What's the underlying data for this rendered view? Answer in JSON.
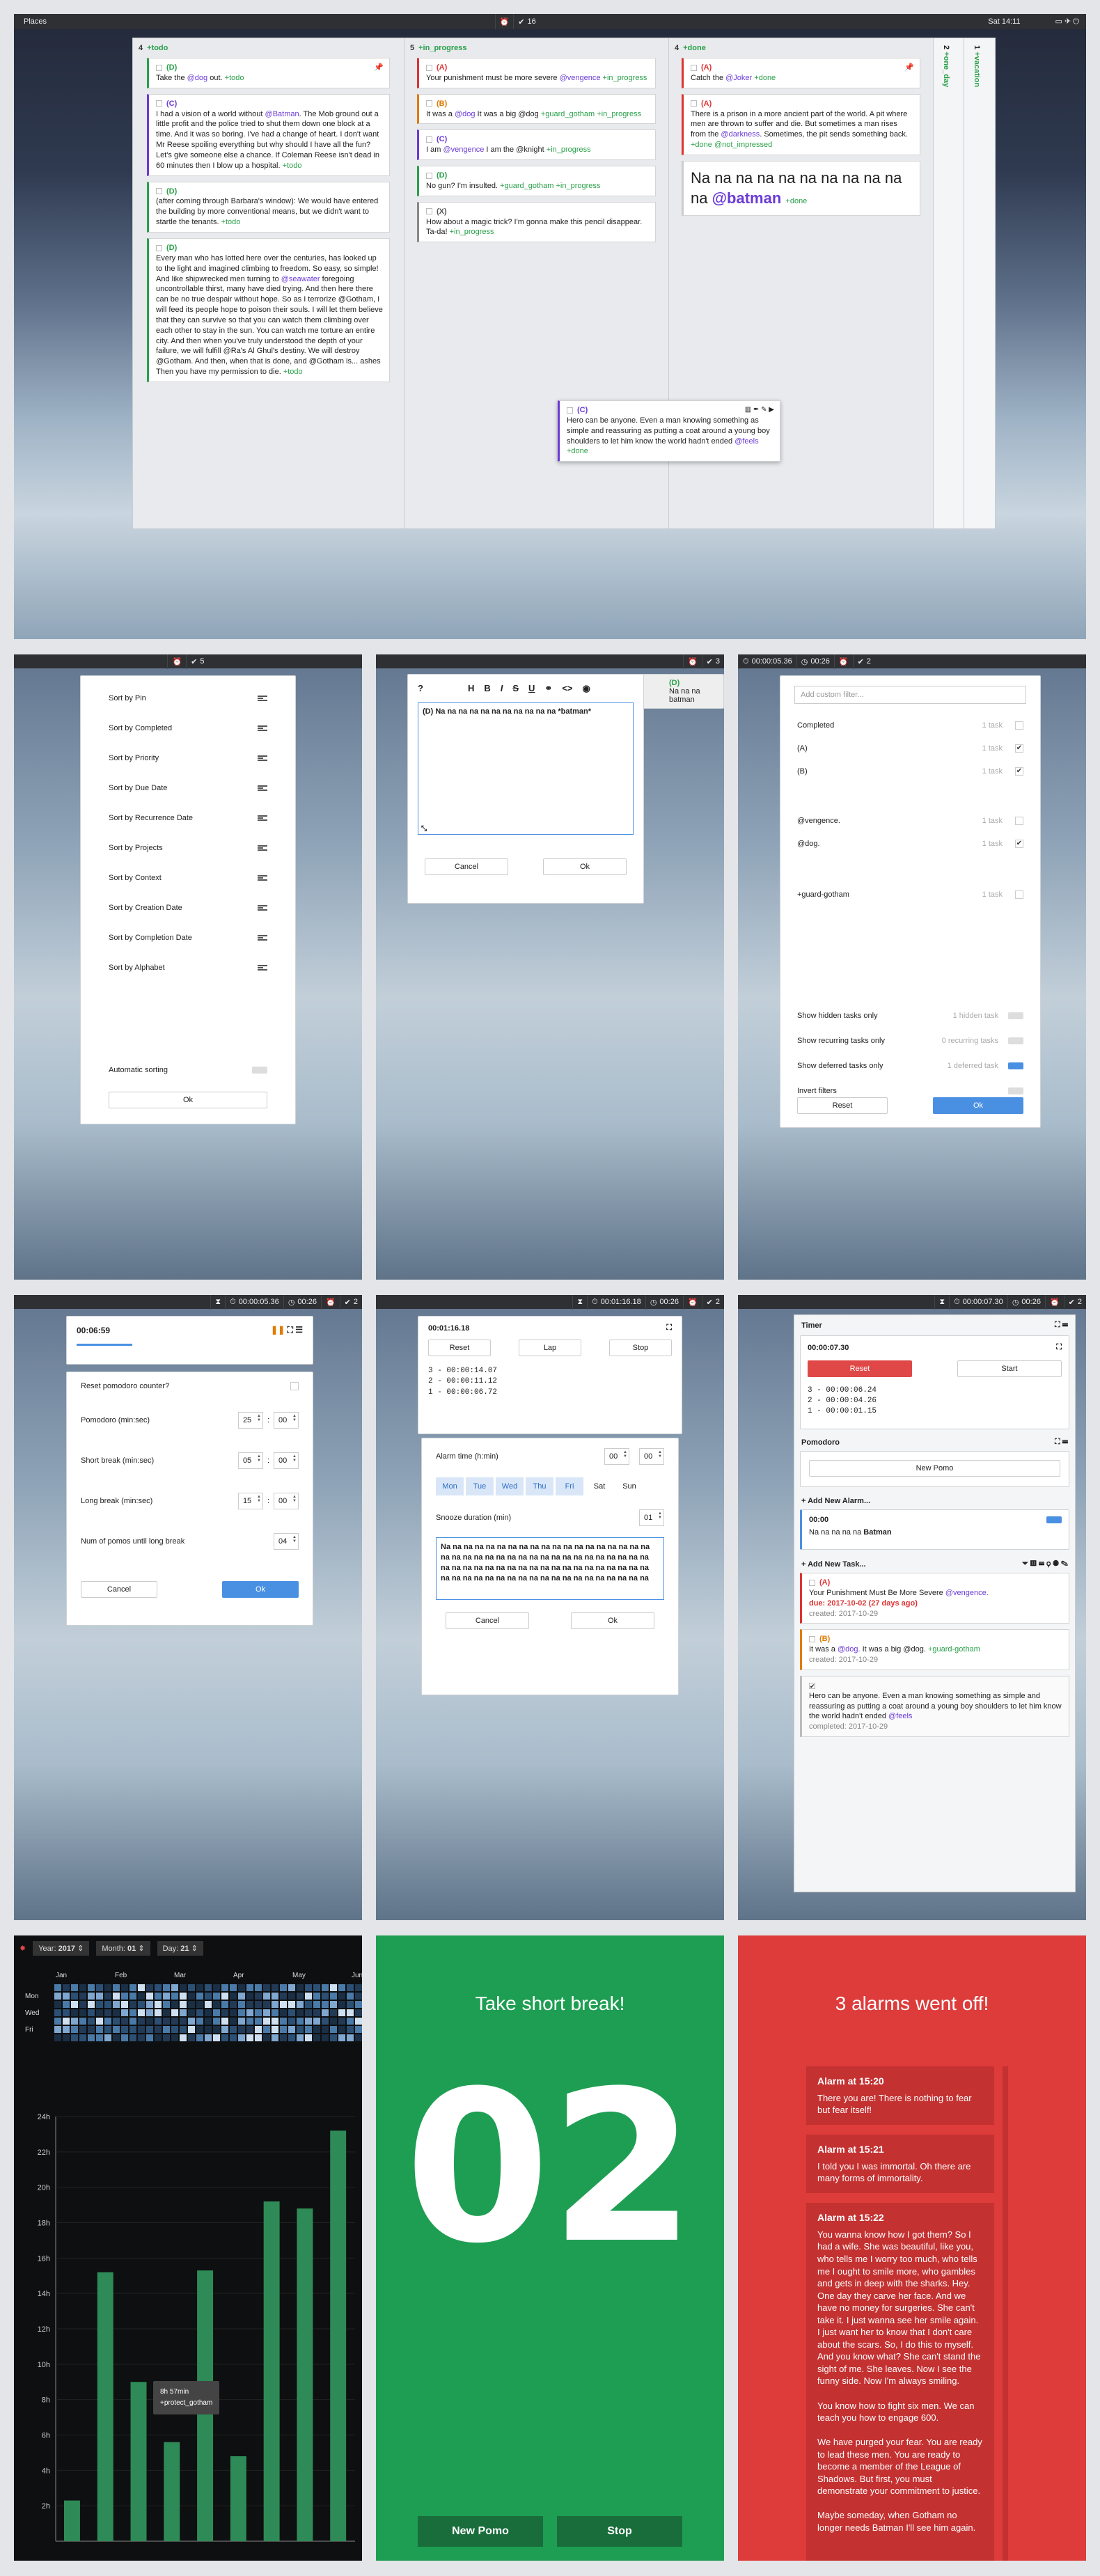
{
  "p1": {
    "topbar": {
      "title": "Places",
      "count": "16",
      "clock": "Sat 14:11"
    },
    "col_todo": {
      "count": "4",
      "title": "+todo",
      "tasks": [
        {
          "pri": "(D)",
          "text": "Take the ",
          "ctx": "@dog",
          "rest": " out. ",
          "tag": "+todo",
          "pinned": true
        },
        {
          "pri": "(C)",
          "text": "I had a vision of a world without ",
          "ctx": "@Batman",
          "rest": ". The Mob ground out a little profit and the police tried to shut them down one block at a time. And it was so boring. I've had a change of heart. I don't want Mr Reese spoiling everything but why should I have all the fun? Let's give someone else a chance. If Coleman Reese isn't dead in 60 minutes then I blow up a hospital. ",
          "tag": "+todo"
        },
        {
          "pri": "(D)",
          "text": "(after coming through Barbara's window): We would have entered the building by more conventional means, but we didn't want to startle the tenants. ",
          "ctx": "",
          "rest": "",
          "tag": "+todo"
        },
        {
          "pri": "(D)",
          "text": "Every man who has lotted here over the centuries, has looked up to the light and imagined climbing to freedom. So easy, so simple! And like shipwrecked men turning to ",
          "ctx": "@seawater",
          "rest": " foregoing uncontrollable thirst, many have died trying. And then here there can be no true despair without hope. So as I terrorize @Gotham, I will feed its people hope to poison their souls. I will let them believe that they can survive so that you can watch them climbing over each other to stay in the sun. You can watch me torture an entire city. And then when you've truly understood the depth of your failure, we will fulfill @Ra's Al Ghul's destiny. We will destroy @Gotham. And then, when that is done, and @Gotham is... ashes Then you have my permission to die. ",
          "tag": "+todo"
        }
      ]
    },
    "col_prog": {
      "count": "5",
      "title": "+in_progress",
      "tasks": [
        {
          "pri": "(A)",
          "text": "Your punishment must be more severe ",
          "ctx": "@vengence",
          "rest": " ",
          "tag": "+in_progress",
          "color": "#d33"
        },
        {
          "pri": "(B)",
          "text": "It was a ",
          "ctx": "@dog",
          "rest": " It was a big @dog ",
          "tag": "+guard_gotham +in_progress",
          "color": "#e07b00"
        },
        {
          "pri": "(C)",
          "text": "I am ",
          "ctx": "@vengence",
          "rest": " I am the @knight ",
          "tag": "+in_progress",
          "color": "#6b3bd6"
        },
        {
          "pri": "(D)",
          "text": "No gun? I'm insulted. ",
          "ctx": "",
          "rest": "",
          "tag": "+guard_gotham +in_progress",
          "color": "#2aa04a"
        },
        {
          "pri": "(X)",
          "text": "How about a magic trick? I'm gonna make this pencil disappear. Ta-da! ",
          "ctx": "",
          "rest": "",
          "tag": "+in_progress",
          "color": "#888"
        }
      ]
    },
    "col_done": {
      "count": "4",
      "title": "+done",
      "tasks": [
        {
          "pri": "(A)",
          "text": "Catch the ",
          "ctx": "@Joker",
          "rest": " ",
          "tag": "+done"
        },
        {
          "pri": "(A)",
          "text": "There is a prison in a more ancient part of the world. A pit where men are thrown to suffer and die. But sometimes a man rises from the ",
          "ctx": "@darkness",
          "rest": ". Sometimes, the pit sends something back. ",
          "tag": "+done @not_impressed"
        },
        {
          "pri": "",
          "text": "Na na na na na na na na na na na ",
          "ctx": "@batman",
          "rest": " ",
          "tag": "+done"
        }
      ]
    },
    "floating": {
      "pri": "(C)",
      "text": "Hero can be anyone. Even a man knowing something as simple and reassuring as putting a coat around a young boy shoulders to let him know the world hadn't ended ",
      "ctx": "@feels",
      "tag": "+done"
    },
    "side1": {
      "num": "2",
      "label": "+one_day"
    },
    "side2": {
      "num": "1",
      "label": "+vacation"
    }
  },
  "p2": {
    "count": "5",
    "items": [
      "Sort by Pin",
      "Sort by Completed",
      "Sort by Priority",
      "Sort by Due Date",
      "Sort by Recurrence Date",
      "Sort by Projects",
      "Sort by Context",
      "Sort by Creation Date",
      "Sort by Completion Date",
      "Sort by Alphabet"
    ],
    "auto": "Automatic sorting",
    "ok": "Ok"
  },
  "p3": {
    "count": "3",
    "toolbar": [
      "?",
      "H",
      "B",
      "I",
      "S",
      "U",
      "<>"
    ],
    "text": "(D) Na na na na na na na na na na na *batman*",
    "cancel": "Cancel",
    "ok": "Ok",
    "peek_pri": "(D)",
    "peek_text": "Na na na batman"
  },
  "p4": {
    "timer": "00:00:05.36",
    "pomo": "00:26",
    "count": "2",
    "placeholder": "Add custom filter...",
    "filters": [
      {
        "label": "Completed",
        "info": "1 task",
        "checked": false
      },
      {
        "label": "(A)",
        "info": "1 task",
        "checked": true
      },
      {
        "label": "(B)",
        "info": "1 task",
        "checked": true
      },
      {
        "label": "@vengence.",
        "info": "1 task",
        "checked": false
      },
      {
        "label": "@dog.",
        "info": "1 task",
        "checked": true
      },
      {
        "label": "+guard-gotham",
        "info": "1 task",
        "checked": false
      }
    ],
    "toggles": [
      {
        "label": "Show hidden tasks only",
        "info": "1 hidden task",
        "on": false
      },
      {
        "label": "Show recurring tasks only",
        "info": "0 recurring tasks",
        "on": false
      },
      {
        "label": "Show deferred tasks only",
        "info": "1 deferred task",
        "on": true
      },
      {
        "label": "Invert filters",
        "info": "",
        "on": false
      }
    ],
    "reset": "Reset",
    "ok": "Ok"
  },
  "p5": {
    "timer": "00:00:05.36",
    "pomo": "00:26",
    "count": "2",
    "time": "00:06:59",
    "reset_label": "Reset pomodoro counter?",
    "fields": [
      {
        "label": "Pomodoro (min:sec)",
        "a": "25",
        "b": "00"
      },
      {
        "label": "Short break (min:sec)",
        "a": "05",
        "b": "00"
      },
      {
        "label": "Long break (min:sec)",
        "a": "15",
        "b": "00"
      },
      {
        "label": "Num of pomos until long break",
        "a": "",
        "b": "04"
      }
    ],
    "cancel": "Cancel",
    "ok": "Ok"
  },
  "p6": {
    "timer": "00:01:16.18",
    "pomo": "00:26",
    "count": "2",
    "sw_time": "00:01:16.18",
    "reset": "Reset",
    "lap": "Lap",
    "stop": "Stop",
    "laps": [
      "3 - 00:00:14.07",
      "2 - 00:00:11.12",
      "1 - 00:00:06.72"
    ],
    "alarm_label": "Alarm time (h:min)",
    "h": "00",
    "m": "00",
    "days": [
      "Mon",
      "Tue",
      "Wed",
      "Thu",
      "Fri",
      "Sat",
      "Sun"
    ],
    "snooze_label": "Snooze duration (min)",
    "snooze": "01",
    "msg": "Na na na na na na na na na na na na na na na na na na na na na na na na na na na na na na na na na na na na na na na na na na na na na na na na na na na na na na na na na na na na na na na na na na na na na na na na na na na na",
    "cancel": "Cancel",
    "ok": "Ok"
  },
  "p7": {
    "timer": "00:00:07.30",
    "pomo": "00:26",
    "count": "2",
    "timer_title": "Timer",
    "t_time": "00:00:07.30",
    "reset": "Reset",
    "start": "Start",
    "laps": [
      "3 - 00:00:06.24",
      "2 - 00:00:04.26",
      "1 - 00:00:01.15"
    ],
    "pomo_title": "Pomodoro",
    "new_pomo": "New Pomo",
    "add_alarm": "Add New Alarm...",
    "alarm_time": "00:00",
    "alarm_text": "Na na na na na ",
    "alarm_ctx": "Batman",
    "add_task": "Add New Task...",
    "tasks": [
      {
        "pri": "(A)",
        "text": "Your Punishment Must Be More Severe ",
        "ctx": "@vengence.",
        "due": "due: 2017-10-02 (27 days ago)",
        "created": "created: 2017-10-29",
        "color": "#d33"
      },
      {
        "pri": "(B)",
        "text": "It was a ",
        "ctx": "@dog.",
        "rest": " It was a big @dog. ",
        "tag": "+guard-gotham",
        "created": "created: 2017-10-29",
        "color": "#e07b00"
      },
      {
        "pri": "",
        "text": "Hero can be anyone. Even a man knowing something as simple and reassuring as putting a coat around a young boy shoulders to let him know the world hadn't ended ",
        "ctx": "@feels",
        "created": "completed: 2017-10-29",
        "color": "#bbb"
      }
    ]
  },
  "p8": {
    "year_label": "Year:",
    "year": "2017",
    "month_label": "Month:",
    "month": "01",
    "day_label": "Day:",
    "day": "21",
    "months": [
      "Jan",
      "Feb",
      "Mar",
      "Apr",
      "May",
      "Jun"
    ],
    "weekdays": [
      "Mon",
      "Wed",
      "Fri"
    ],
    "tooltip_time": "8h 57min",
    "tooltip_tag": "+protect_gotham"
  },
  "p9": {
    "title": "Take short break!",
    "big": "02",
    "new_pomo": "New Pomo",
    "stop": "Stop"
  },
  "p10": {
    "title": "3 alarms went off!",
    "alarms": [
      {
        "title": "Alarm at 15:20",
        "text": "There you are! There is nothing to fear but fear itself!"
      },
      {
        "title": "Alarm at 15:21",
        "text": "I told you I was immortal. Oh there are many forms of immortality."
      },
      {
        "title": "Alarm at 15:22",
        "text": "You wanna know how I got them? So I had a wife. She was beautiful, like you, who tells me I worry too much, who tells me I ought to smile more, who gambles and gets in deep with the sharks. Hey. One day they carve her face. And we have no money for surgeries. She can't take it. I just wanna see her smile again. I just want her to know that I don't care about the scars. So, I do this to myself. And you know what? She can't stand the sight of me. She leaves. Now I see the funny side. Now I'm always smiling.\n\nYou know how to fight six men. We can teach you how to engage 600.\n\nWe have purged your fear. You are ready to lead these men. You are ready to become a member of the League of Shadows. But first, you must demonstrate your commitment to justice.\n\nMaybe someday, when Gotham no longer needs Batman I'll see him again."
      }
    ]
  },
  "chart_data": {
    "type": "bar",
    "title": "",
    "ylabel": "",
    "y_ticks": [
      "2h",
      "4h",
      "6h",
      "8h",
      "10h",
      "12h",
      "14h",
      "16h",
      "18h",
      "20h",
      "22h",
      "24h"
    ],
    "ylim": [
      0,
      24
    ],
    "values": [
      2.3,
      15.2,
      9,
      5.6,
      15.3,
      4.8,
      19.2,
      18.8,
      23.2
    ],
    "highlight_value": "8h 57min",
    "colors": {
      "bar": "#2e8b57",
      "bg": "#111"
    }
  }
}
